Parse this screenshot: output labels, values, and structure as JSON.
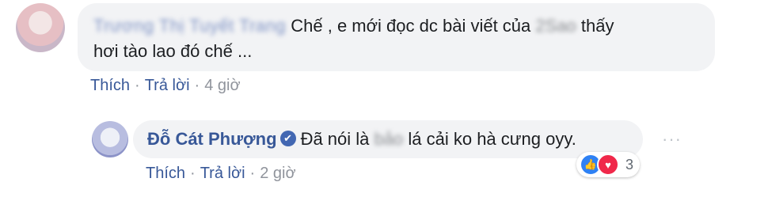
{
  "comment1": {
    "author": "Trương Thị Tuyết Trang",
    "text_line1_before": "Chế , e mới đọc dc bài viết của",
    "blurred_word": "2Sao",
    "text_line1_after": "thấy",
    "text_line2": "hơi tào lao đó chế ...",
    "actions": {
      "like": "Thích",
      "reply": "Trả lời",
      "time": "4 giờ"
    }
  },
  "comment2": {
    "author": "Đỗ Cát Phượng",
    "text_before": "Đã nói là",
    "blurred_word": "bảo",
    "text_after": "lá cải ko hà cưng oyy.",
    "actions": {
      "like": "Thích",
      "reply": "Trả lời",
      "time": "2 giờ"
    },
    "reactions": {
      "count": "3",
      "types": [
        "like-icon",
        "love-icon"
      ]
    }
  },
  "colors": {
    "link": "#385898",
    "bubble": "#f2f3f5",
    "meta": "#90949c",
    "like_reaction": "#2e81f4",
    "love_reaction": "#f0284a"
  }
}
